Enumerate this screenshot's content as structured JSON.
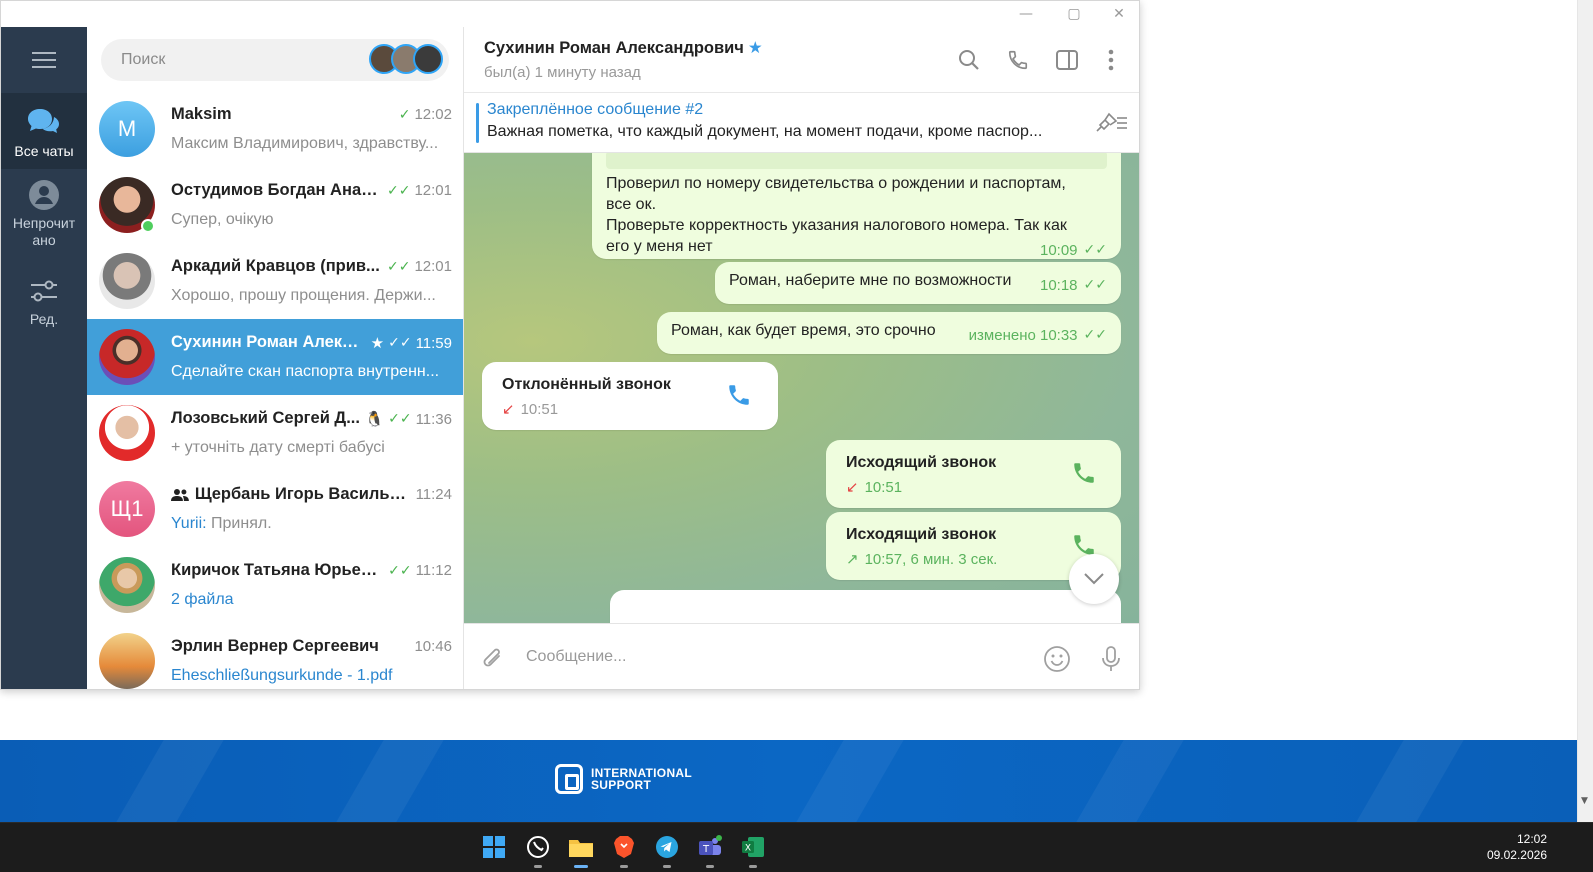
{
  "colors": {
    "accent": "#419fd9",
    "rail": "#2b3b4e",
    "outgoing_bubble": "#effdde",
    "check_green": "#4ab34e"
  },
  "rail": {
    "all_chats": "Все чаты",
    "unread": "Непрочит ано",
    "edit": "Ред."
  },
  "search": {
    "placeholder": "Поиск"
  },
  "chats": [
    {
      "name": "Maksim",
      "time": "12:02",
      "preview": "Максим Владимирович, здравству...",
      "avatar_letter": "M",
      "checks": "✓"
    },
    {
      "name": "Остудимов Богдан Анат...",
      "time": "12:01",
      "preview": "Супер, очікую",
      "checks": "✓✓"
    },
    {
      "name": "Аркадий Кравцов (прив...",
      "time": "12:01",
      "preview": "Хорошо, прошу прощения. Держи...",
      "checks": "✓✓"
    },
    {
      "name": "Сухинин Роман Алекс...",
      "time": "11:59",
      "preview": "Сделайте скан паспорта внутренн...",
      "checks": "✓✓"
    },
    {
      "name": "Лозовський Сергей Д...",
      "time": "11:36",
      "preview": "+ уточніть дату смерті бабусі",
      "checks": "✓✓"
    },
    {
      "name": "Щербань Игорь Василье...",
      "time": "11:24",
      "preview_sender": "Yurii:",
      "preview": " Принял.",
      "avatar_letter": "Щ1"
    },
    {
      "name": "Киричок Татьяна Юрьев...",
      "time": "11:12",
      "preview": "2 файла",
      "checks": "✓✓"
    },
    {
      "name": "Эрлин Вернер Сергеевич",
      "time": "10:46",
      "preview": "Eheschließungsurkunde - 1.pdf"
    }
  ],
  "header": {
    "name": "Сухинин Роман Александрович",
    "status": "был(а) 1 минуту назад"
  },
  "pinned": {
    "title": "Закреплённое сообщение #2",
    "text": "Важная пометка, что каждый документ, на момент подачи, кроме паспор..."
  },
  "messages": {
    "m1_line1": "Проверил по номеру свидетельства о рождении и паспортам,",
    "m1_line2": "все ок.",
    "m1_line3": "Проверьте корректность указания налогового номера. Так как",
    "m1_line4": "его у меня нет",
    "m1_time": "10:09",
    "m2_text": "Роман, наберите мне по возможности",
    "m2_time": "10:18",
    "m3_text": "Роман, как будет время, это срочно",
    "m3_time": "изменено 10:33",
    "call1_title": "Отклонённый звонок",
    "call1_time": "10:51",
    "call2_title": "Исходящий звонок",
    "call2_time": "10:51",
    "call3_title": "Исходящий звонок",
    "call3_time": "10:57, 6 мин. 3 сек."
  },
  "composer": {
    "placeholder": "Сообщение..."
  },
  "banner": {
    "line1": "INTERNATIONAL",
    "line2": "SUPPORT"
  },
  "taskbar": {
    "time": "12:02",
    "date": "09.02.2026"
  }
}
